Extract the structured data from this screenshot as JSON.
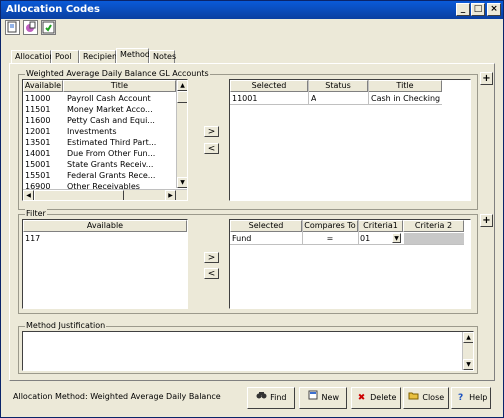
{
  "window": {
    "title": "Allocation Codes",
    "minimize": "_",
    "maximize": "□",
    "close": "×"
  },
  "tabs": [
    "Allocation",
    "Pool",
    "Recipient",
    "Method",
    "Notes"
  ],
  "accounts_group": {
    "label": "Weighted Average Daily Balance GL Accounts",
    "available_headers": [
      "Available",
      "Title"
    ],
    "available_rows": [
      [
        "11000",
        "Payroll Cash Account"
      ],
      [
        "11501",
        "Money Market Acco..."
      ],
      [
        "11600",
        "Petty Cash and Equi..."
      ],
      [
        "12001",
        "Investments"
      ],
      [
        "13501",
        "Estimated Third Part..."
      ],
      [
        "14001",
        "Due From Other Fun..."
      ],
      [
        "15001",
        "State Grants Receiv..."
      ],
      [
        "15501",
        "Federal Grants Rece..."
      ],
      [
        "16900",
        "Other Receivables"
      ]
    ],
    "selected_headers": [
      "Selected",
      "Status",
      "Title"
    ],
    "selected_rows": [
      [
        "11001",
        "A",
        "Cash in Checking"
      ]
    ],
    "add_arrow": ">",
    "remove_arrow": "<",
    "plus": "+"
  },
  "filter_group": {
    "label": "Filter",
    "available_header": "Available",
    "available_rows": [
      "117"
    ],
    "selected_headers": [
      "Selected",
      "Compares To",
      "Criteria1",
      "Criteria 2"
    ],
    "selected_rows": [
      [
        "Fund",
        "=",
        "01",
        ""
      ]
    ],
    "add_arrow": ">",
    "remove_arrow": "<",
    "plus": "+"
  },
  "justification_group": {
    "label": "Method Justification",
    "value": ""
  },
  "status_text": "Allocation Method: Weighted Average Daily Balance",
  "footer_buttons": [
    {
      "label": "Find",
      "icon": "binoculars-icon",
      "glyph": "👓"
    },
    {
      "label": "New",
      "icon": "new-document-icon",
      "glyph": "▤"
    },
    {
      "label": "Delete",
      "icon": "delete-x-icon",
      "glyph": "✖"
    },
    {
      "label": "Close",
      "icon": "folder-close-icon",
      "glyph": "▰"
    },
    {
      "label": "Help",
      "icon": "help-icon",
      "glyph": "?"
    }
  ],
  "colors": {
    "title_bar": "#0a3fa0",
    "face": "#ece9d8",
    "delete_red": "#cc0000",
    "help_blue": "#1a50c0"
  }
}
